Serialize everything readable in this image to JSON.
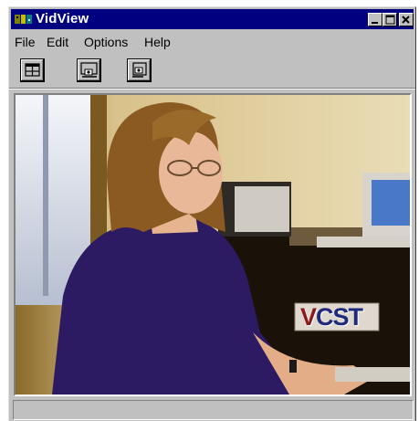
{
  "window": {
    "title": "VidView"
  },
  "menu": [
    {
      "label": "File"
    },
    {
      "label": "Edit"
    },
    {
      "label": "Options"
    },
    {
      "label": "Help"
    }
  ],
  "toolbar": {
    "buttons": [
      {
        "icon": "window-view-icon"
      },
      {
        "icon": "camera-send-icon"
      },
      {
        "icon": "camera-receive-icon"
      }
    ]
  },
  "video": {
    "watermark": "VCST"
  },
  "status": {
    "text": ""
  },
  "colors": {
    "titlebar": "#000080",
    "face": "#c0c0c0",
    "watermark_v": "#8b1a1a",
    "watermark_cst": "#1f2a7a"
  }
}
